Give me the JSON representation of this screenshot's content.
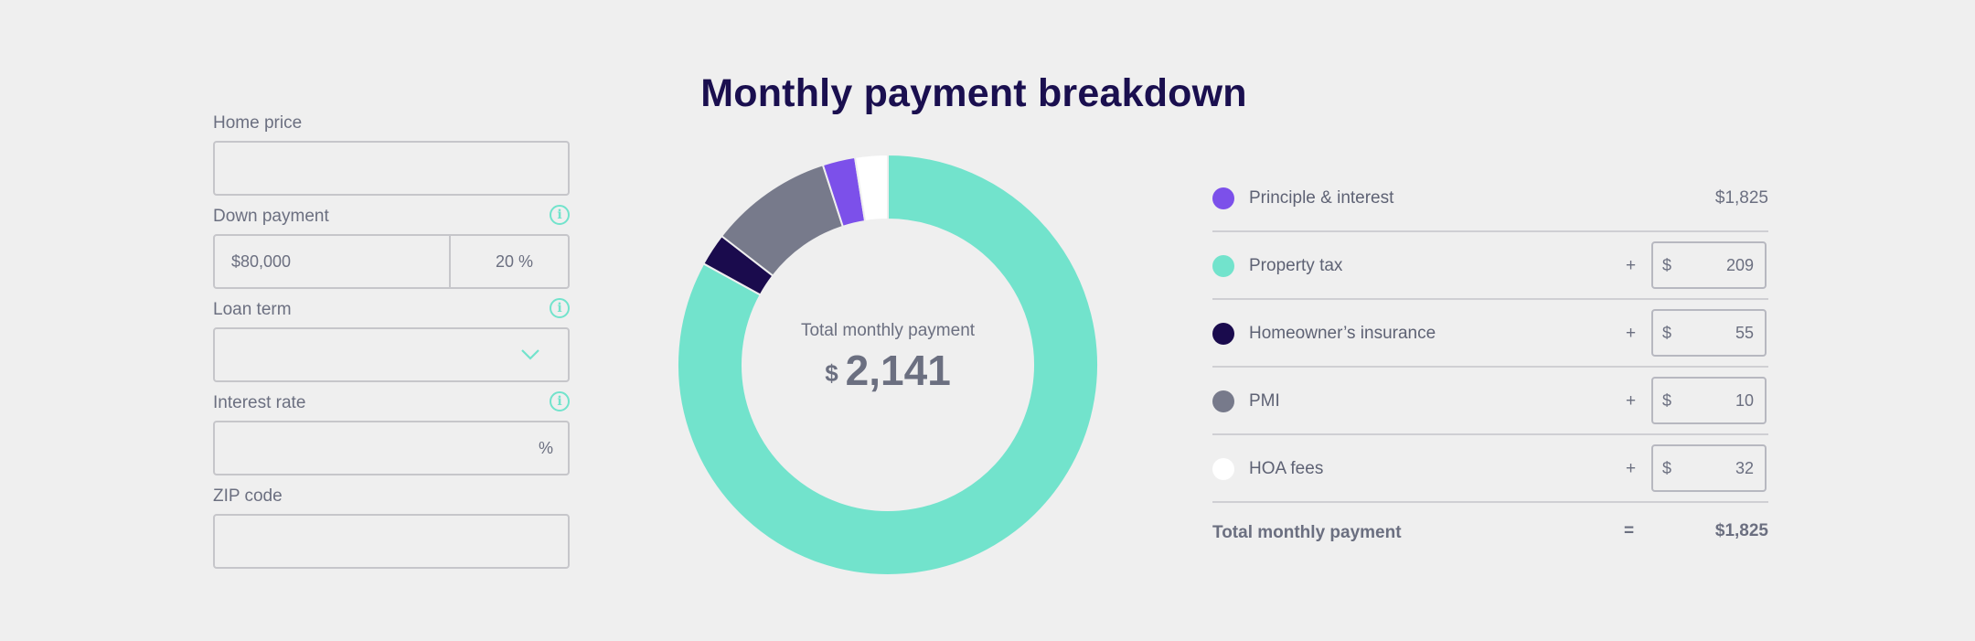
{
  "title": "Monthly payment breakdown",
  "form": {
    "home_price": {
      "label": "Home price",
      "value": ""
    },
    "down_payment": {
      "label": "Down payment",
      "amount": "$80,000",
      "percent": "20 %"
    },
    "loan_term": {
      "label": "Loan term",
      "value": ""
    },
    "interest_rate": {
      "label": "Interest rate",
      "value": "",
      "suffix": "%"
    },
    "zip_code": {
      "label": "ZIP code",
      "value": ""
    },
    "info_glyph": "i"
  },
  "donut": {
    "center_label": "Total monthly payment",
    "center_currency": "$",
    "center_value": "2,141"
  },
  "breakdown": {
    "rows": [
      {
        "label": "Principle & interest",
        "value": "$1,825",
        "color": "#7c50ea",
        "editable": false
      },
      {
        "label": "Property tax",
        "sign": "+",
        "currency": "$",
        "value": "209",
        "color": "#72e3cc",
        "editable": true
      },
      {
        "label": "Homeowner’s insurance",
        "sign": "+",
        "currency": "$",
        "value": "55",
        "color": "#1a0b4d",
        "editable": true
      },
      {
        "label": "PMI",
        "sign": "+",
        "currency": "$",
        "value": "10",
        "color": "#777a8b",
        "editable": true
      },
      {
        "label": "HOA fees",
        "sign": "+",
        "currency": "$",
        "value": "32",
        "color": "#ffffff",
        "editable": true
      }
    ],
    "total": {
      "label": "Total monthly payment",
      "sign": "=",
      "value": "$1,825"
    }
  },
  "chart_data": {
    "type": "pie",
    "categories": [
      "Principle & interest",
      "Property tax",
      "Homeowner’s insurance",
      "PMI",
      "HOA fees"
    ],
    "values": [
      55,
      1825,
      32,
      209,
      55
    ],
    "order_clockwise_from_top": [
      "Property tax",
      "Homeowner’s insurance",
      "PMI",
      "Principle & interest",
      "HOA fees"
    ],
    "slice_values": [
      1825,
      55,
      209,
      55,
      55
    ],
    "colors": [
      "#72e3cc",
      "#1a0b4d",
      "#777a8b",
      "#7c50ea",
      "#ffffff"
    ],
    "donut": true
  }
}
